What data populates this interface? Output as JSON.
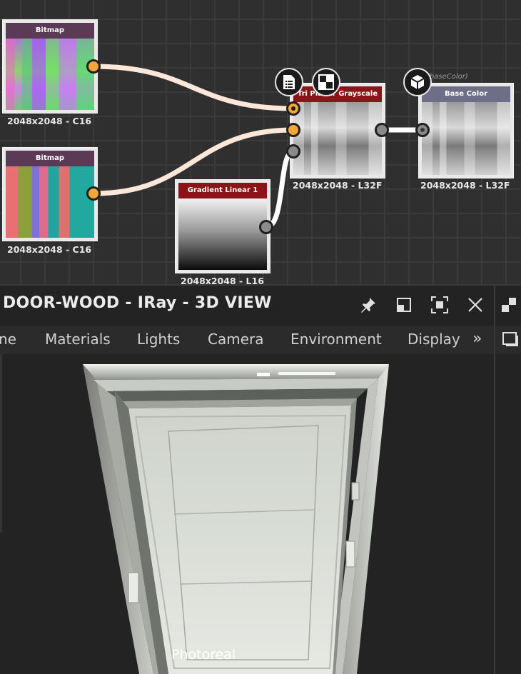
{
  "graph": {
    "nodes": [
      {
        "id": "bitmap1",
        "title": "Bitmap",
        "caption": "2048x2048 - C16",
        "header_color": "#5a3a55"
      },
      {
        "id": "bitmap2",
        "title": "Bitmap",
        "caption": "2048x2048 - C16",
        "header_color": "#5a3a55"
      },
      {
        "id": "gradient",
        "title": "Gradient Linear 1",
        "caption": "2048x2048 - L16",
        "header_color": "#8a1418"
      },
      {
        "id": "triplanar",
        "title": "Tri Planar Grayscale",
        "caption": "2048x2048 - L32F",
        "header_color": "#8a1418"
      },
      {
        "id": "basecolor",
        "title": "Base Color",
        "caption": "2048x2048 - L32F",
        "header_color": "#6e6e86"
      }
    ],
    "ghost_label": "(baseColor)",
    "icons": {
      "triplanar_left": "document-list-icon",
      "triplanar_right": "checker-icon",
      "basecolor": "cube-icon"
    },
    "colors": {
      "wire_cream": "#fde7d8",
      "wire_white": "#ffffff",
      "port_orange": "#f4a63a",
      "port_gray": "#8a8a8a"
    }
  },
  "view": {
    "title": "DOOR-WOOD - IRay - 3D VIEW",
    "buttons": {
      "pin": "pin-icon",
      "restore": "restore-icon",
      "fullscreen": "fullscreen-icon",
      "close": "close-icon"
    },
    "tabs": [
      "ne",
      "Materials",
      "Lights",
      "Camera",
      "Environment",
      "Display"
    ],
    "more": "»",
    "render_mode": "Photoreal"
  },
  "side": {
    "icons": [
      "checker-icon",
      "window-icon"
    ]
  }
}
